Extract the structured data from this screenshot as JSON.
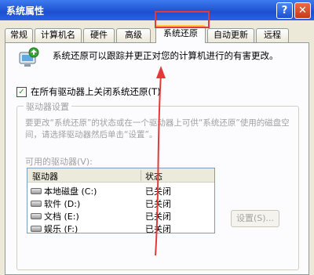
{
  "window": {
    "title": "系统属性",
    "help_glyph": "?",
    "close_glyph": "✕"
  },
  "tabs": [
    {
      "label": "常规"
    },
    {
      "label": "计算机名"
    },
    {
      "label": "硬件"
    },
    {
      "label": "高级"
    },
    {
      "label": "系统还原",
      "active": true
    },
    {
      "label": "自动更新"
    },
    {
      "label": "远程"
    }
  ],
  "system_restore": {
    "description": "系统还原可以跟踪并更正对您的计算机进行的有害更改。",
    "icon": "system-restore-icon",
    "disable_all": {
      "label": "在所有驱动器上关闭系统还原(T)",
      "checked": true
    },
    "group": {
      "title": "驱动器设置",
      "description": "要更改“系统还原”的状态或在一个驱动器上可供“系统还原”使用的磁盘空间，请选择驱动器然后单击“设置”。",
      "available_label": "可用的驱动器(V):",
      "columns": [
        "驱动器",
        "状态"
      ],
      "drives": [
        {
          "name": "本地磁盘  (C:)",
          "status": "已关闭"
        },
        {
          "name": "软件  (D:)",
          "status": "已关闭"
        },
        {
          "name": "文档  (E:)",
          "status": "已关闭"
        },
        {
          "name": "娱乐  (F:)",
          "status": "已关闭"
        }
      ],
      "settings_button": "设置(S)..."
    }
  },
  "colors": {
    "titlebar": "#2459d8",
    "highlight_box": "#e23a3a",
    "tab_accent": "#ffc83c"
  }
}
